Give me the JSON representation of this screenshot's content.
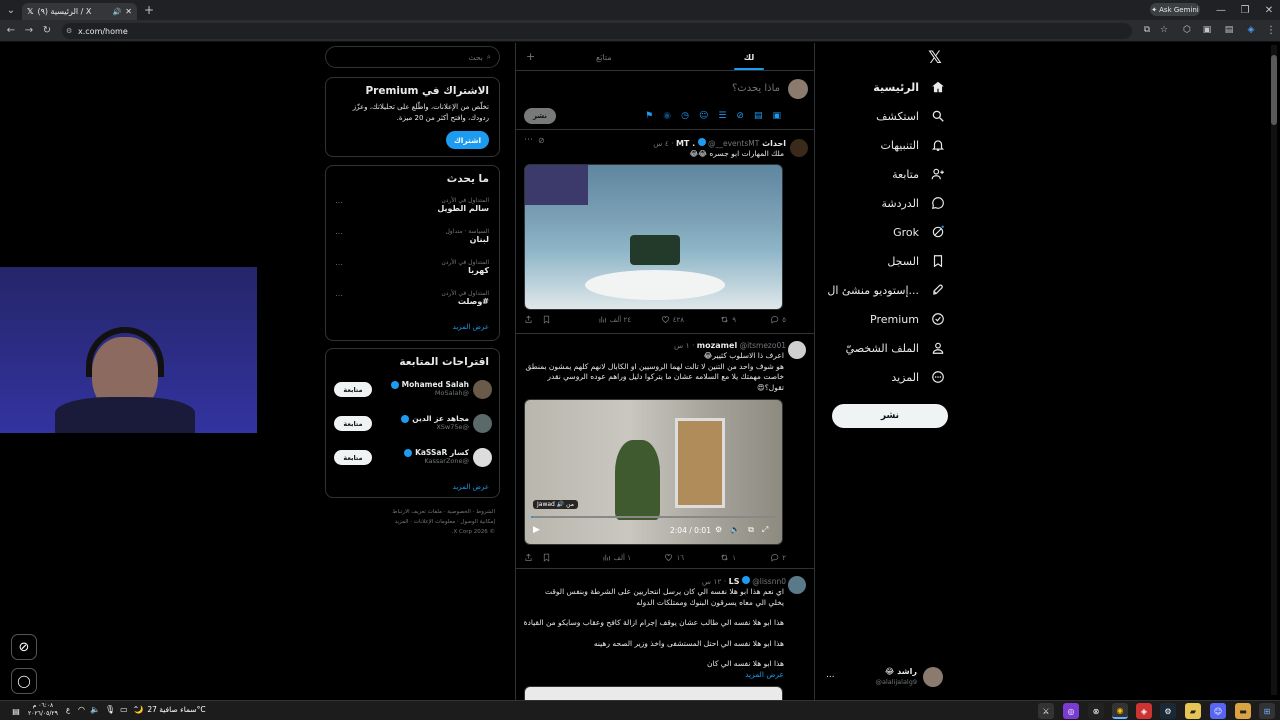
{
  "browser": {
    "tab_title": "(٩) الرئيسية / X",
    "url": "x.com/home",
    "gemini_label": "Ask Gemini"
  },
  "nav": {
    "items": [
      {
        "label": "الرئيسية",
        "icon": "home-icon"
      },
      {
        "label": "استكشف",
        "icon": "search-icon"
      },
      {
        "label": "التنبيهات",
        "icon": "bell-icon"
      },
      {
        "label": "متابعة",
        "icon": "add-user-icon"
      },
      {
        "label": "الدردشة",
        "icon": "chat-icon"
      },
      {
        "label": "Grok",
        "icon": "grok-icon"
      },
      {
        "label": "السجل",
        "icon": "bookmark-icon"
      },
      {
        "label": "إستوديو منشئ ال...",
        "icon": "rocket-icon"
      },
      {
        "label": "Premium",
        "icon": "premium-icon"
      },
      {
        "label": "الملف الشخصيّ",
        "icon": "profile-icon"
      },
      {
        "label": "المزيد",
        "icon": "more-icon"
      }
    ],
    "post_button": "نشر",
    "account_name": "راشد 😂",
    "account_handle": "@alalijalalg9",
    "account_more": "..."
  },
  "feed": {
    "tab_for_you": "لك",
    "tab_following": "متابَع",
    "compose_placeholder": "ماذا يحدث؟",
    "compose_post": "نشر",
    "posts": [
      {
        "name": "احداث MT .",
        "handle": "@__eventsMT",
        "time": "· ٤ س",
        "text": "ملك المهارات ابو جسره 😂😂",
        "replies": "٥",
        "reposts": "٩",
        "likes": "٤٢٨",
        "views": "٢٤ ألف"
      },
      {
        "name": "mozamel",
        "handle": "@itsmezo01",
        "time": "· ١ س",
        "text_lines": [
          "اعرف ذا الاسلوب كثيير😂",
          "هو شوف واحد من التنين لا تالت لهما الروسيين او الكابال لانهم كلهم يمشون بمنطق",
          "خاصت مهمتك يلا مع السلامه عشان ما يتركوا دليل وراهم عوده الروسي نقدر",
          "تقول؟😍"
        ],
        "video_time": "2:04 / 0:01",
        "video_overlay": "Jawad 🔊 من",
        "replies": "٢",
        "reposts": "١",
        "likes": "١٦",
        "views": "١ ألف"
      },
      {
        "name": "LS",
        "handle": "@lissnn0",
        "time": "· ١٢ س",
        "text_lines": [
          "اي نعم هذا ابو هلا نفسه الي كان يرسل انتحاريين على الشرطة وبنفس الوقت",
          "يخلي الي معاه يسرقون البنوك وممتلكات الدوله",
          "",
          "هذا ابو هلا نفسه الي طالب عشان يوقف إجرام ازالة كافح وعقاب وسايكو من القيادة",
          "",
          "هذا ابو هلا نفسه الي احتل المستشفى واخذ وزير الصحه رهينه",
          "",
          "هذا ابو هلا نفسه الي كان"
        ],
        "show_more": "عرض المزيد"
      }
    ]
  },
  "sidebar": {
    "search_placeholder": "بحث",
    "premium": {
      "title": "الاشتراك في Premium",
      "body_lines": [
        "تخلّص من الإعلانات، واطّلع على تحليلاتك، وعزّز",
        "ردودك، وافتح أكثر من 20 ميزة."
      ],
      "button": "اشتراك"
    },
    "trends": {
      "title": "ما يحدث",
      "items": [
        {
          "meta": "المتداول في الأردن",
          "topic": "سالم الطويل"
        },
        {
          "meta": "السياسة · متداول",
          "topic": "لبنان"
        },
        {
          "meta": "المتداول في الأردن",
          "topic": "كهربا"
        },
        {
          "meta": "المتداول في الأردن",
          "topic": "#وصلت"
        }
      ],
      "show_more": "عرض المزيد"
    },
    "suggestions": {
      "title": "اقتراحات المتابعة",
      "items": [
        {
          "name": "Mohamed Salah",
          "handle": "@MoSalah",
          "button": "متابعة"
        },
        {
          "name": "مجاهد عز الدين",
          "handle": "@XSw75e",
          "button": "متابعة"
        },
        {
          "name": "كسار KaSSaR",
          "handle": "@KassarZone",
          "button": "متابعة"
        }
      ],
      "show_more": "عرض المزيد"
    },
    "footer_lines": [
      "الشروط · الخصوصية · ملفات تعريف الارتباط",
      "إمكانية الوصول · معلومات الإعلانات · المزيد",
      "© 2026 X Corp."
    ]
  },
  "taskbar": {
    "weather": "سماء صافية 27°C",
    "clock_time": "٠٦:٠٨ م",
    "clock_date": "٢٠٢٦/٠٥/٢٩",
    "lang": "ع"
  },
  "colors": {
    "accent": "#1d9bf0",
    "background": "#000000",
    "text": "#e7e9ea",
    "muted": "#71767b",
    "border": "#2f3336"
  }
}
